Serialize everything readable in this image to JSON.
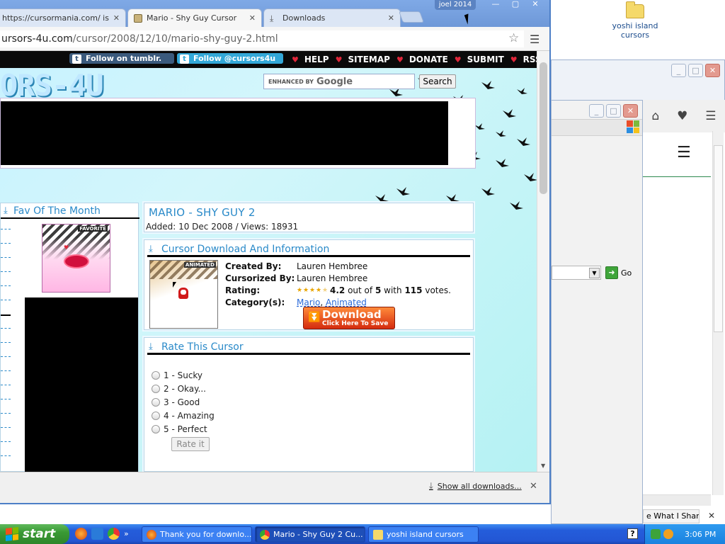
{
  "desktop": {
    "icon_label": "yoshi island cursors"
  },
  "browser": {
    "tabs": [
      {
        "title": "https://cursormania.com/ is a...",
        "active": false
      },
      {
        "title": "Mario - Shy Guy Cursor",
        "active": true
      },
      {
        "title": "Downloads",
        "active": false
      }
    ],
    "user": "joel 2014",
    "url_host": "ursors-4u.com",
    "url_path": "/cursor/2008/12/10/mario-shy-guy-2.html"
  },
  "site": {
    "logo": "ORS-4U",
    "social": {
      "tumblr_badge": "t",
      "tumblr": "Follow on tumblr.",
      "twitter_badge": "t",
      "twitter": "Follow @cursors4u"
    },
    "nav": [
      "HELP",
      "SITEMAP",
      "DONATE",
      "SUBMIT",
      "RSS"
    ],
    "search": {
      "enhanced": "ENHANCED BY",
      "google": "Google",
      "button": "Search"
    }
  },
  "fav": {
    "heading": "Fav Of The Month",
    "badge": "FAVORITE"
  },
  "cursor": {
    "title": "MARIO - SHY GUY 2",
    "meta": "Added: 10 Dec 2008 / Views: 18931",
    "info_heading": "Cursor Download And Information",
    "badge": "ANIMATED",
    "created_label": "Created By:",
    "created_value": "Lauren Hembree",
    "cursorized_label": "Cursorized By:",
    "cursorized_value": "Lauren Hembree",
    "rating_label": "Rating:",
    "rating_value": "4.2",
    "rating_of": "out of",
    "rating_max": "5",
    "rating_with": "with",
    "votes": "115",
    "votes_suffix": "votes.",
    "stars": 4.2,
    "category_label": "Category(s):",
    "categories": [
      "Mario",
      "Animated"
    ],
    "download_big": "Download",
    "download_small": "Click Here To Save"
  },
  "rate": {
    "heading": "Rate This Cursor",
    "options": [
      "1 - Sucky",
      "2 - Okay...",
      "3 - Good",
      "4 - Amazing",
      "5 - Perfect"
    ],
    "button": "Rate it"
  },
  "shelf": {
    "show_all": "Show all downloads..."
  },
  "bg_windows": {
    "go": "Go",
    "share_tab": "e What I Share"
  },
  "taskbar": {
    "start": "start",
    "items": [
      {
        "label": "Thank you for downlo..."
      },
      {
        "label": "Mario - Shy Guy 2 Cu..."
      },
      {
        "label": "yoshi island cursors"
      }
    ],
    "help": "?",
    "clock": "3:06 PM"
  },
  "colors": {
    "accent_blue": "#2a8ac9",
    "nav_heart": "#e0263a",
    "download_orange": "#d42b0f",
    "taskbar_blue": "#245ddb",
    "start_green": "#3a9a35"
  }
}
